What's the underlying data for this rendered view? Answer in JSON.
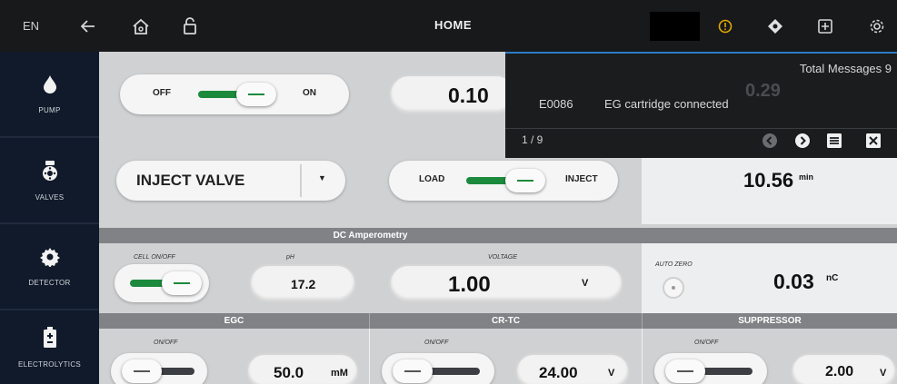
{
  "topbar": {
    "language": "EN",
    "title": "HOME",
    "icons": [
      "back-arrow-icon",
      "home-icon",
      "unlock-icon",
      "alert-icon",
      "locate-icon",
      "add-box-icon",
      "gear-icon"
    ],
    "alert_color": "#e0a800"
  },
  "sidebar": {
    "items": [
      {
        "label": "PUMP",
        "icon": "drop-icon"
      },
      {
        "label": "VALVES",
        "icon": "valve-icon"
      },
      {
        "label": "DETECTOR",
        "icon": "gear-icon"
      },
      {
        "label": "ELECTROLYTICS",
        "icon": "battery-icon"
      }
    ]
  },
  "pump": {
    "off_label": "OFF",
    "on_label": "ON",
    "flow_value": "0.10"
  },
  "valves": {
    "select_value": "INJECT VALVE",
    "load_label": "LOAD",
    "inject_label": "INJECT",
    "time_value": "10.56",
    "time_unit": "min"
  },
  "detector": {
    "section_title": "DC Amperometry",
    "cell_label": "CELL ON/OFF",
    "ph_label": "pH",
    "ph_value": "17.2",
    "voltage_label": "VOLTAGE",
    "voltage_value": "1.00",
    "voltage_unit": "V",
    "autozero_label": "AUTO ZERO",
    "charge_value": "0.03",
    "charge_unit": "nC"
  },
  "egc": {
    "title": "EGC",
    "onoff_label": "ON/OFF",
    "value": "50.0",
    "unit": "mM"
  },
  "crtc": {
    "title": "CR-TC",
    "onoff_label": "ON/OFF",
    "value": "24.00",
    "unit": "V"
  },
  "suppressor": {
    "title": "SUPPRESSOR",
    "onoff_label": "ON/OFF",
    "value": "2.00",
    "unit": "V"
  },
  "messages": {
    "total_label": "Total Messages 9",
    "code": "E0086",
    "text": "EG cartridge connected",
    "pager": "1 / 9",
    "hidden_value": "0.29"
  },
  "colors": {
    "accent_green": "#1c8a3c",
    "sidebar_bg": "#101a2a",
    "popup_border": "#2b7bc4"
  }
}
